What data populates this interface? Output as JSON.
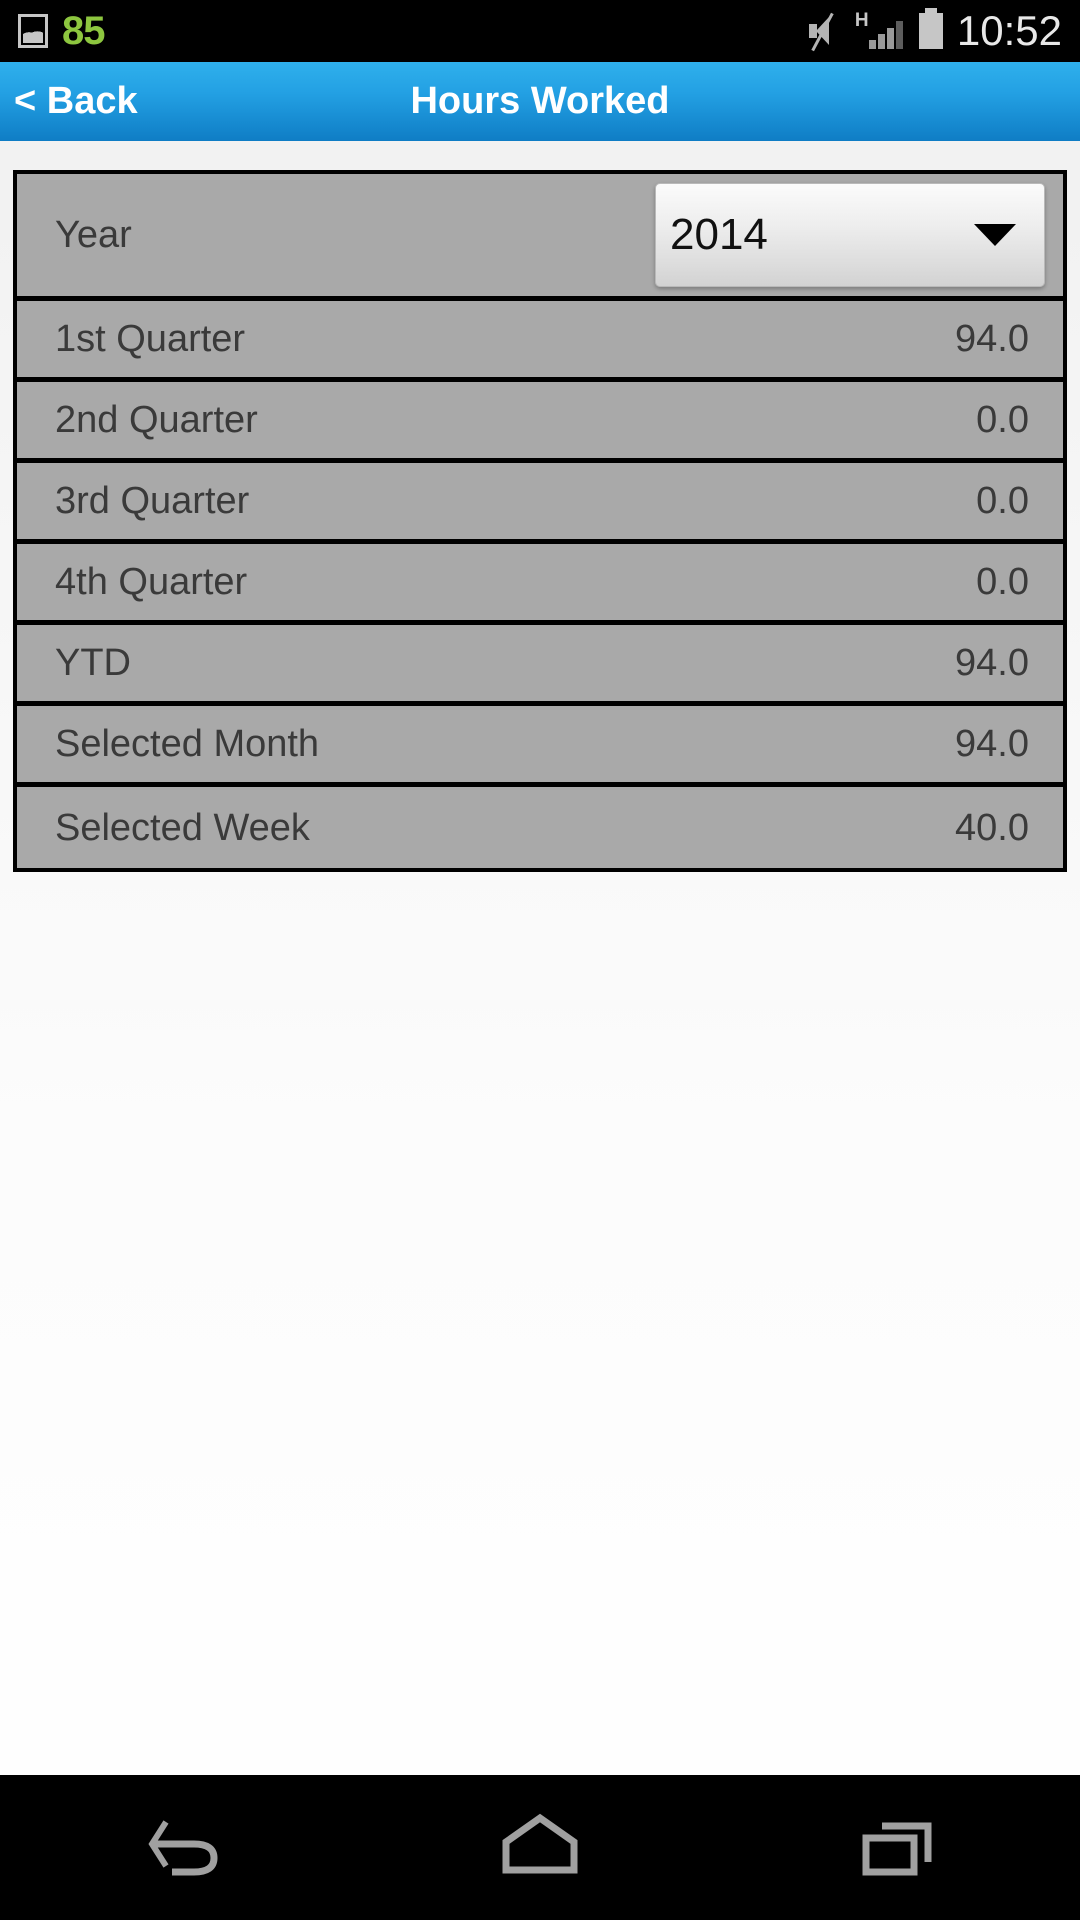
{
  "status_bar": {
    "photo_icon": "photo-icon",
    "notification_count": "85",
    "mute_icon": "mute-icon",
    "signal_type": "H",
    "signal_icon": "signal-bars-icon",
    "battery_icon": "battery-icon",
    "time": "10:52",
    "colors": {
      "background": "#000000",
      "count_green": "#8dc63f",
      "time_text": "#e8e8e8"
    }
  },
  "header": {
    "back_label": "< Back",
    "title": "Hours Worked",
    "colors": {
      "gradient_top": "#2fb0ec",
      "gradient_bottom": "#0f7dc5",
      "text": "#ffffff"
    }
  },
  "list": {
    "year_row": {
      "label": "Year",
      "selected_value": "2014",
      "caret_icon": "chevron-down-icon"
    },
    "rows": [
      {
        "label": "1st Quarter",
        "value": "94.0"
      },
      {
        "label": "2nd Quarter",
        "value": "0.0"
      },
      {
        "label": "3rd Quarter",
        "value": "0.0"
      },
      {
        "label": "4th Quarter",
        "value": "0.0"
      },
      {
        "label": "YTD",
        "value": "94.0"
      },
      {
        "label": "Selected Month",
        "value": "94.0"
      },
      {
        "label": "Selected Week",
        "value": "40.0"
      }
    ],
    "colors": {
      "row_background": "#a9a9a9",
      "divider": "#000000",
      "text": "#3a3a3a"
    }
  },
  "nav_bar": {
    "back_icon": "back-arrow-icon",
    "home_icon": "home-icon",
    "recents_icon": "recent-apps-icon",
    "colors": {
      "background": "#000000",
      "icon": "#a0a0a0"
    }
  }
}
